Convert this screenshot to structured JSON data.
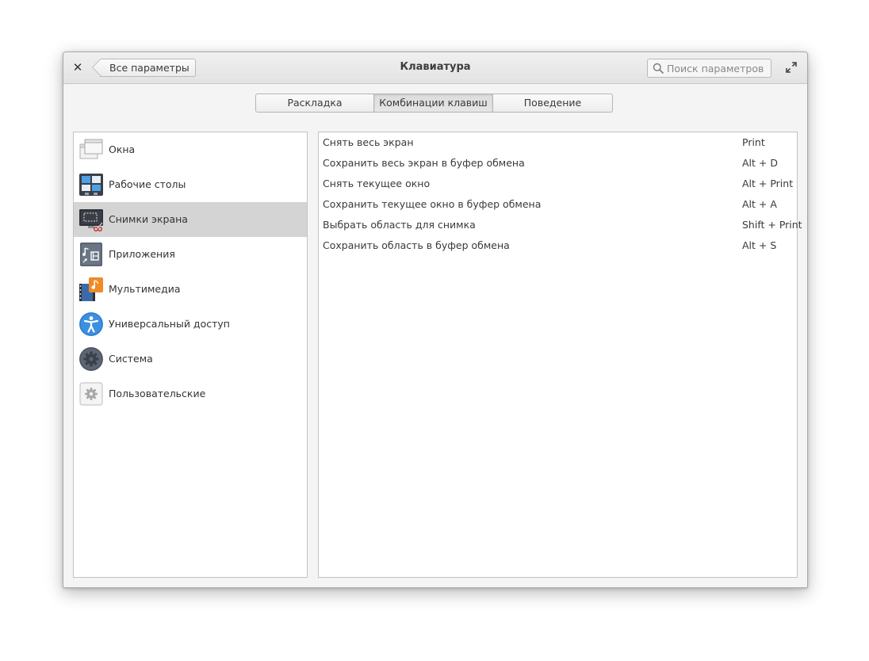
{
  "window": {
    "title": "Клавиатура",
    "back_label": "Все параметры",
    "search_placeholder": "Поиск параметров"
  },
  "tabs": [
    {
      "label": "Раскладка",
      "active": false
    },
    {
      "label": "Комбинации клавиш",
      "active": true
    },
    {
      "label": "Поведение",
      "active": false
    }
  ],
  "sidebar": {
    "selected_index": 2,
    "items": [
      {
        "label": "Окна",
        "icon": "windows-icon"
      },
      {
        "label": "Рабочие столы",
        "icon": "workspaces-icon"
      },
      {
        "label": "Снимки экрана",
        "icon": "screenshot-icon"
      },
      {
        "label": "Приложения",
        "icon": "applications-icon"
      },
      {
        "label": "Мультимедиа",
        "icon": "multimedia-icon"
      },
      {
        "label": "Универсальный доступ",
        "icon": "accessibility-icon"
      },
      {
        "label": "Система",
        "icon": "system-gear-icon"
      },
      {
        "label": "Пользовательские",
        "icon": "custom-gear-icon"
      }
    ]
  },
  "shortcuts": [
    {
      "name": "Снять весь экран",
      "keys": "Print"
    },
    {
      "name": "Сохранить весь экран в буфер обмена",
      "keys": "Alt + D"
    },
    {
      "name": "Снять текущее окно",
      "keys": "Alt + Print"
    },
    {
      "name": "Сохранить текущее окно в буфер обмена",
      "keys": "Alt + A"
    },
    {
      "name": "Выбрать область для снимка",
      "keys": "Shift + Print"
    },
    {
      "name": "Сохранить область в буфер обмена",
      "keys": "Alt + S"
    }
  ],
  "colors": {
    "selection": "#d4d4d4",
    "window_bg": "#f4f4f4",
    "accessibility_blue": "#3d8fe0",
    "multimedia_orange": "#f08a24"
  }
}
